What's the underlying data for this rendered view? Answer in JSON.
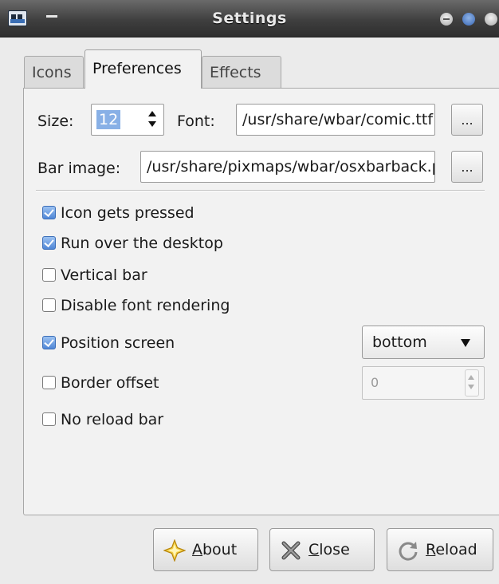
{
  "window": {
    "title": "Settings"
  },
  "tabs": [
    {
      "label": "Icons",
      "active": false
    },
    {
      "label": "Preferences",
      "active": true
    },
    {
      "label": "Effects",
      "active": false
    }
  ],
  "preferences": {
    "size_label": "Size:",
    "size_value": "12",
    "font_label": "Font:",
    "font_value": "/usr/share/wbar/comic.ttf",
    "bar_image_label": "Bar image:",
    "bar_image_value": "/usr/share/pixmaps/wbar/osxbarback.png",
    "browse_label": "...",
    "options": [
      {
        "label": "Icon gets pressed",
        "checked": true
      },
      {
        "label": "Run over the desktop",
        "checked": true
      },
      {
        "label": "Vertical bar",
        "checked": false
      },
      {
        "label": "Disable font rendering",
        "checked": false
      },
      {
        "label": "Position screen",
        "checked": true
      },
      {
        "label": "Border offset",
        "checked": false
      },
      {
        "label": "No reload bar",
        "checked": false
      }
    ],
    "position_value": "bottom",
    "border_offset_value": "0"
  },
  "buttons": {
    "about": {
      "mnemonic": "A",
      "rest": "bout"
    },
    "close": {
      "mnemonic": "C",
      "rest": "lose"
    },
    "reload": {
      "mnemonic": "R",
      "rest": "eload"
    }
  },
  "icons": {
    "about": "star-icon",
    "close": "x-icon",
    "reload": "reload-icon"
  }
}
